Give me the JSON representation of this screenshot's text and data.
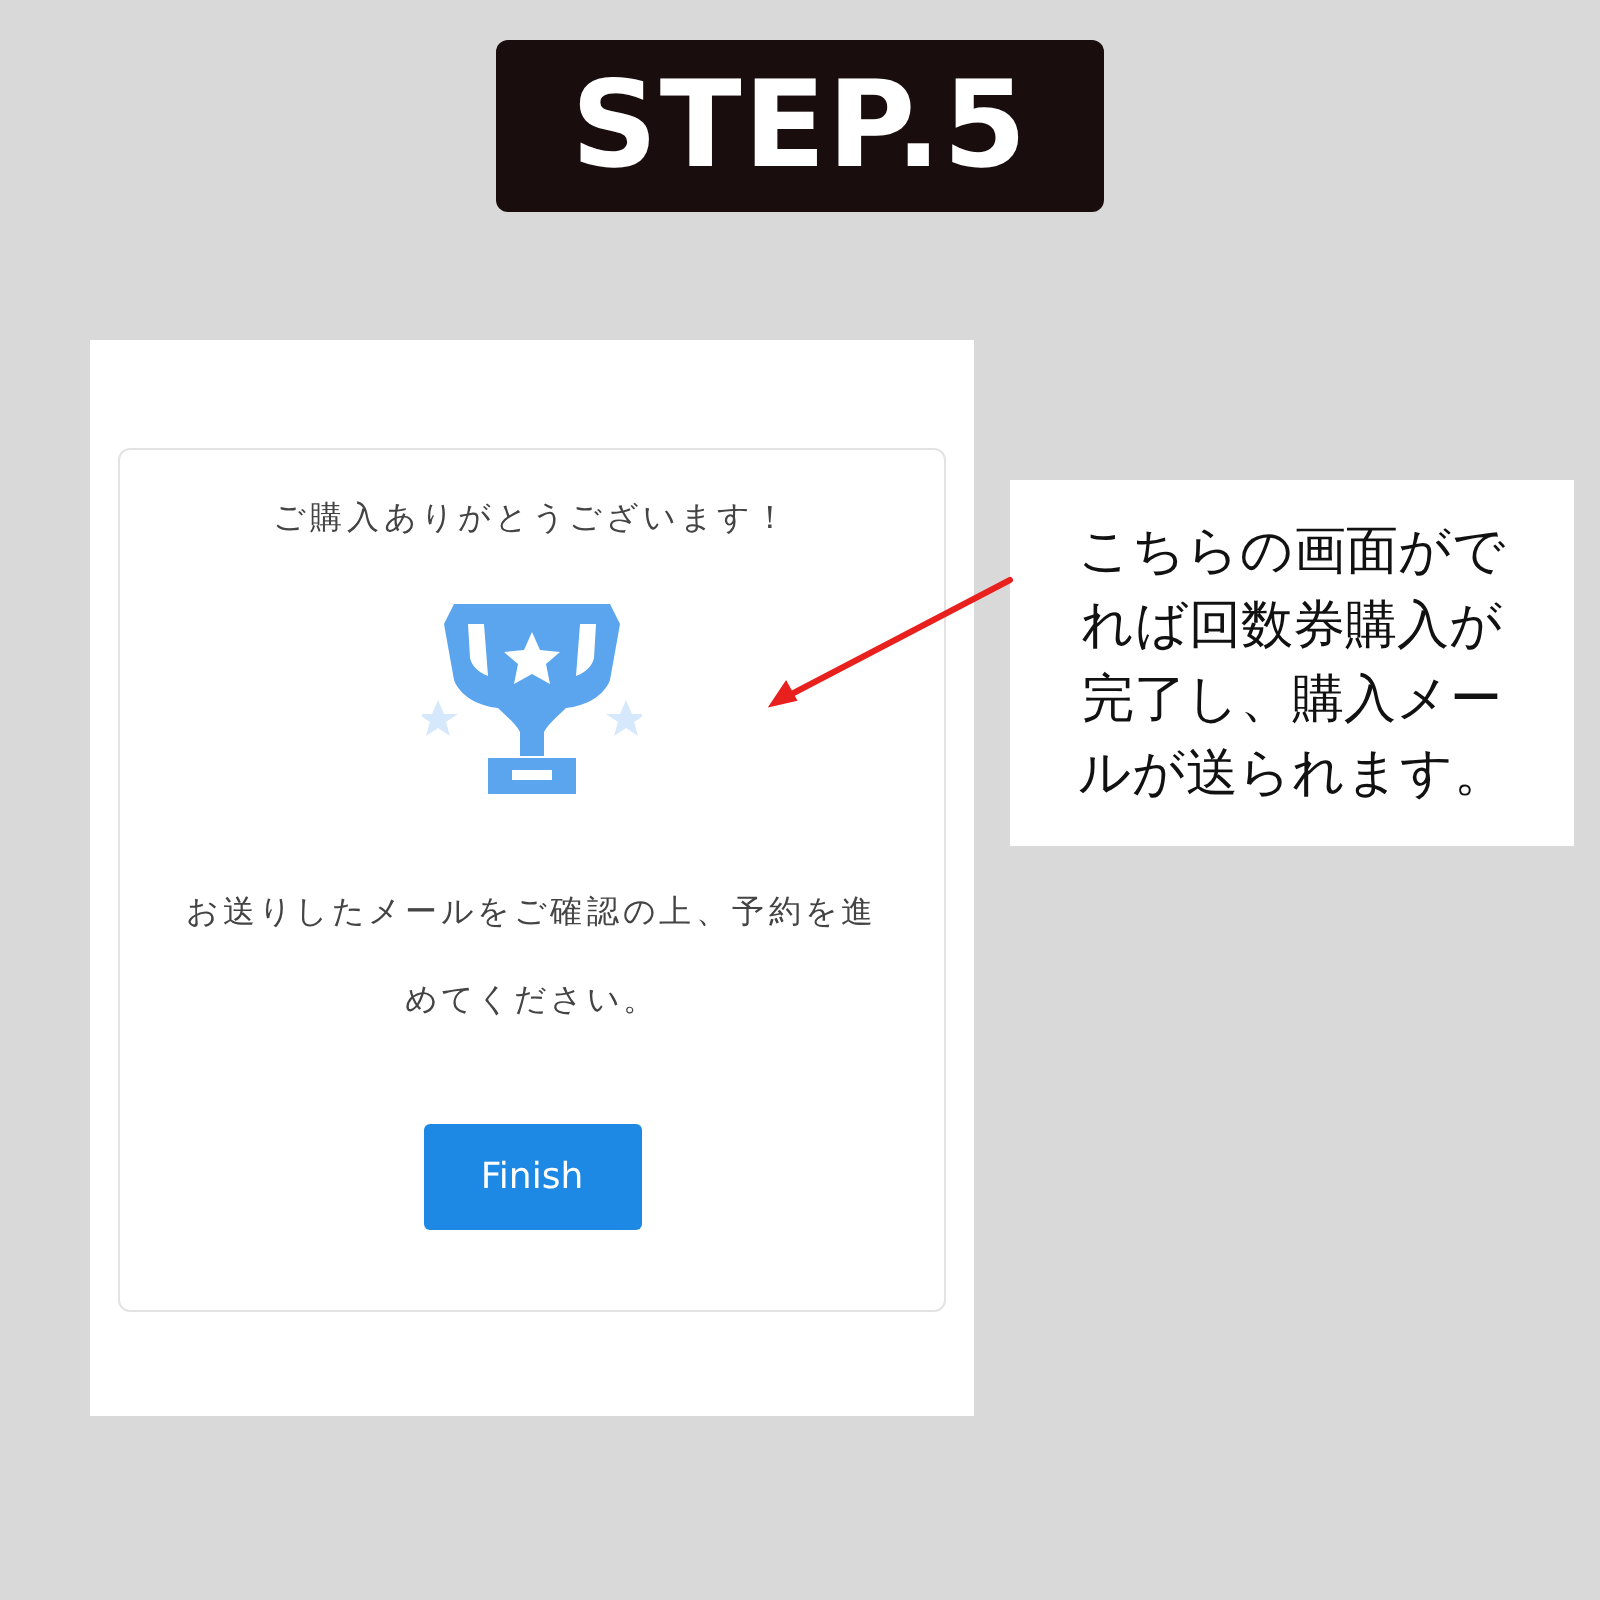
{
  "step_title": "STEP.5",
  "screen": {
    "heading": "ご購入ありがとうございます！",
    "message": "お送りしたメールをご確認の上、予約を進めてください。",
    "button": "Finish"
  },
  "callout": "こちらの画面がでれば回数券購入が完了し、購入メールが送られます。"
}
